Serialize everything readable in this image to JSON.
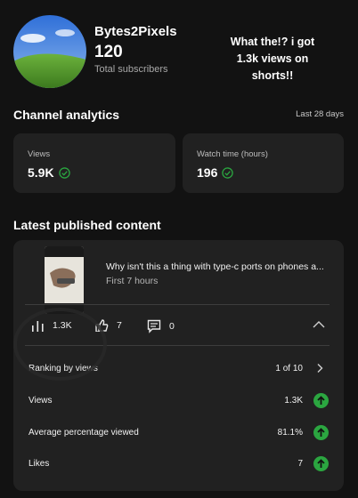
{
  "channel": {
    "name": "Bytes2Pixels",
    "subscribers": "120",
    "subscribers_label": "Total subscribers",
    "avatar_icon": "landscape-avatar"
  },
  "overlay_caption": "What the!? i got 1.3k views on shorts!!",
  "analytics": {
    "title": "Channel analytics",
    "period": "Last 28 days",
    "cards": [
      {
        "label": "Views",
        "value": "5.9K",
        "icon": "check-circle-icon"
      },
      {
        "label": "Watch time (hours)",
        "value": "196",
        "icon": "check-circle-icon"
      }
    ]
  },
  "latest": {
    "title": "Latest published content",
    "video": {
      "title": "Why isn't this a thing with type-c ports on phones a...",
      "subtitle": "First 7 hours"
    },
    "metrics": [
      {
        "icon": "bar-chart-icon",
        "value": "1.3K"
      },
      {
        "icon": "like-icon",
        "value": "7"
      },
      {
        "icon": "comment-icon",
        "value": "0"
      }
    ],
    "ranking": {
      "label": "Ranking by views",
      "value": "1 of 10"
    },
    "rows": [
      {
        "label": "Views",
        "value": "1.3K",
        "icon": "arrow-up-circle-icon"
      },
      {
        "label": "Average percentage viewed",
        "value": "81.1%",
        "icon": "arrow-up-circle-icon"
      },
      {
        "label": "Likes",
        "value": "7",
        "icon": "arrow-up-circle-icon"
      }
    ]
  },
  "colors": {
    "background": "#121212",
    "card": "#212121",
    "positive": "#2ba640"
  }
}
